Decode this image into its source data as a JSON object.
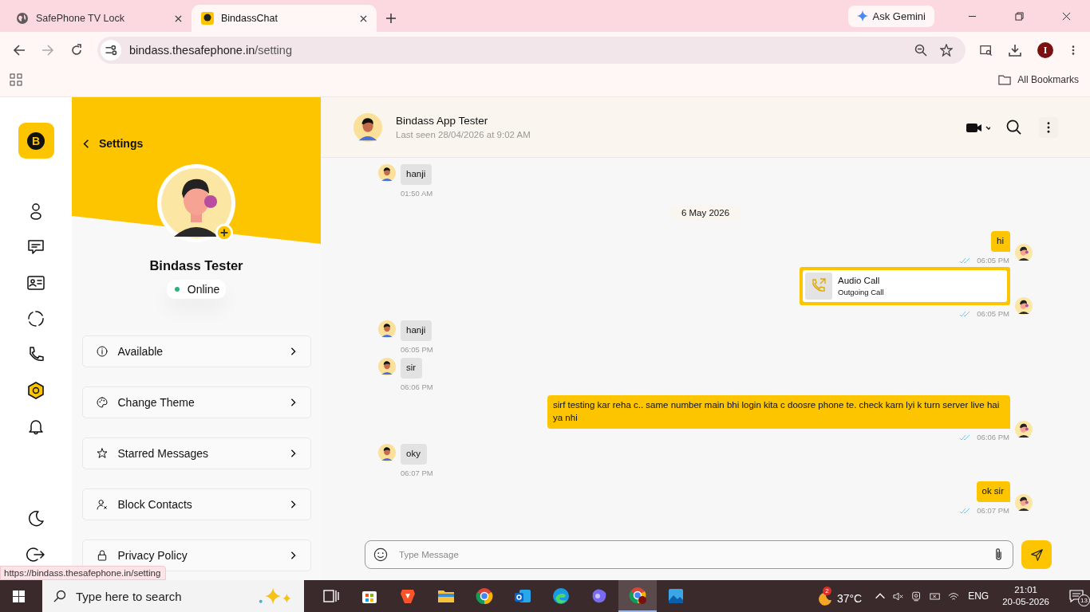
{
  "browser": {
    "tabs": [
      {
        "title": "SafePhone TV Lock",
        "kind": "globe",
        "selected": false
      },
      {
        "title": "BindassChat",
        "kind": "app",
        "selected": true
      }
    ],
    "url_host": "bindass.thesafephone.in",
    "url_path": "/setting",
    "ask_gemini": "Ask Gemini",
    "profile_initial": "I",
    "bookmarks": "All Bookmarks",
    "status_url": "https://bindass.thesafephone.in/setting"
  },
  "rail": {
    "logo_letter": "B",
    "items": [
      {
        "kind": "person",
        "selected": false
      },
      {
        "kind": "chat",
        "selected": false
      },
      {
        "kind": "card",
        "selected": false
      },
      {
        "kind": "status",
        "selected": false
      },
      {
        "kind": "phone",
        "selected": false
      },
      {
        "kind": "settings",
        "selected": true
      },
      {
        "kind": "bell",
        "selected": false
      }
    ],
    "bottom": [
      {
        "kind": "moon"
      },
      {
        "kind": "logout"
      }
    ]
  },
  "settings": {
    "title": "Settings",
    "name": "Bindass Tester",
    "status": "Online",
    "online": true,
    "items": [
      {
        "kind": "info",
        "label": "Available"
      },
      {
        "kind": "palette",
        "label": "Change Theme"
      },
      {
        "kind": "star",
        "label": "Starred Messages"
      },
      {
        "kind": "user-x",
        "label": "Block Contacts"
      },
      {
        "kind": "lock",
        "label": "Privacy Policy"
      }
    ]
  },
  "chat": {
    "contact": "Bindass App Tester",
    "last_seen": "Last seen 28/04/2026 at 9:02 AM",
    "messages": [
      {
        "kind": "text",
        "outgoing": false,
        "text": "hanji",
        "time": "01:50 AM"
      },
      {
        "kind": "date",
        "text": "6 May 2026"
      },
      {
        "kind": "text",
        "outgoing": true,
        "text": "hi",
        "time": "06:05 PM"
      },
      {
        "kind": "call",
        "outgoing": true,
        "title": "Audio Call",
        "subtitle": "Outgoing Call",
        "time": "06:05 PM"
      },
      {
        "kind": "text",
        "outgoing": false,
        "text": "hanji",
        "time": "06:05 PM"
      },
      {
        "kind": "text",
        "outgoing": false,
        "text": "sir",
        "time": "06:06 PM"
      },
      {
        "kind": "text",
        "outgoing": true,
        "text": "sirf testing kar reha c.. same number main bhi login kita c doosre phone te. check karn lyi k turn server live hai ya nhi",
        "time": "06:06 PM"
      },
      {
        "kind": "text",
        "outgoing": false,
        "text": "oky",
        "time": "06:07 PM"
      },
      {
        "kind": "text",
        "outgoing": true,
        "text": "ok sir",
        "time": "06:07 PM"
      }
    ],
    "composer": {
      "placeholder": "Type Message"
    }
  },
  "taskbar": {
    "search_placeholder": "Type here to search",
    "apps": [
      {
        "kind": "taskview",
        "selected": false
      },
      {
        "kind": "store",
        "selected": false
      },
      {
        "kind": "brave",
        "selected": false
      },
      {
        "kind": "folder",
        "selected": false
      },
      {
        "kind": "chrome",
        "selected": false
      },
      {
        "kind": "outlook",
        "selected": false
      },
      {
        "kind": "edge",
        "selected": false
      },
      {
        "kind": "copilot",
        "selected": false
      },
      {
        "kind": "chrome",
        "selected": true
      },
      {
        "kind": "photos",
        "selected": false
      }
    ],
    "weather_badge": "2",
    "temperature": "37°C",
    "language": "ENG",
    "time": "21:01",
    "date": "20-05-2026",
    "notifications": "13"
  }
}
